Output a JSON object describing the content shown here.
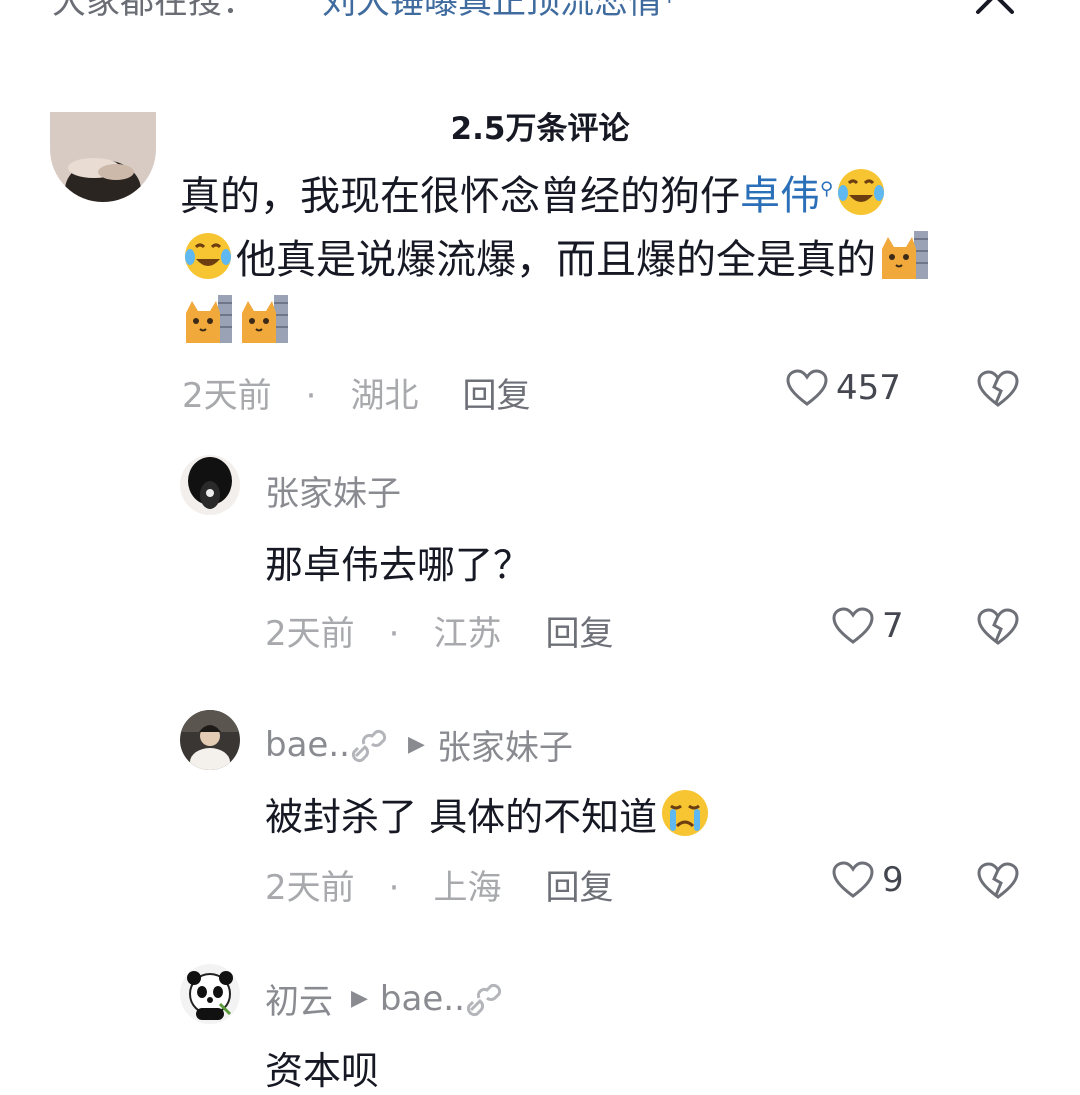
{
  "search_bar": {
    "prefix": "大家都在搜：",
    "term": "刘大锤曝真正顶流恋情",
    "search_icon": "search-icon",
    "close_icon": "close-icon"
  },
  "comments_header": {
    "count_label": "2.5万条评论"
  },
  "main_comment": {
    "text_part1": "真的，我现在很怀念曾经的狗仔",
    "link_text": "卓伟",
    "text_part2": "他真是说爆流爆，而且爆的全是真的",
    "time": "2天前",
    "location": "湖北",
    "reply_label": "回复",
    "likes": "457",
    "icons": [
      "search-icon",
      "joy-tears-emoji",
      "cat-peek-emoji",
      "heart-outline-icon",
      "dislike-heart-icon"
    ]
  },
  "replies": [
    {
      "username": "张家妹子",
      "text": "那卓伟去哪了？",
      "time": "2天前",
      "location": "江苏",
      "reply_label": "回复",
      "likes": "7"
    },
    {
      "username": "bae..",
      "reply_to": "张家妹子",
      "text": "被封杀了 具体的不知道",
      "time": "2天前",
      "location": "上海",
      "reply_label": "回复",
      "likes": "9"
    },
    {
      "username": "初云",
      "reply_to": "bae..",
      "text": "资本呗"
    }
  ],
  "colors": {
    "link": "#2a6fb8",
    "meta": "#a8a9ad",
    "text": "#161823",
    "search_term": "#3f6b9f"
  }
}
